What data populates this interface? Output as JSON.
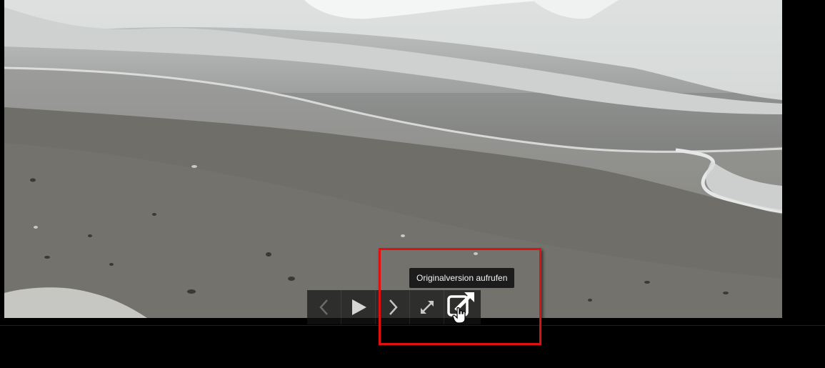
{
  "viewer": {
    "tooltip": "Originalversion aufrufen",
    "toolbar": {
      "buttons": [
        {
          "icon": "chevron-left-icon",
          "enabled": false
        },
        {
          "icon": "play-icon",
          "enabled": true
        },
        {
          "icon": "chevron-right-icon",
          "enabled": true
        },
        {
          "icon": "fullscreen-icon",
          "enabled": true
        },
        {
          "icon": "external-link-icon",
          "enabled": true
        }
      ]
    },
    "highlight_color": "#e01010"
  }
}
